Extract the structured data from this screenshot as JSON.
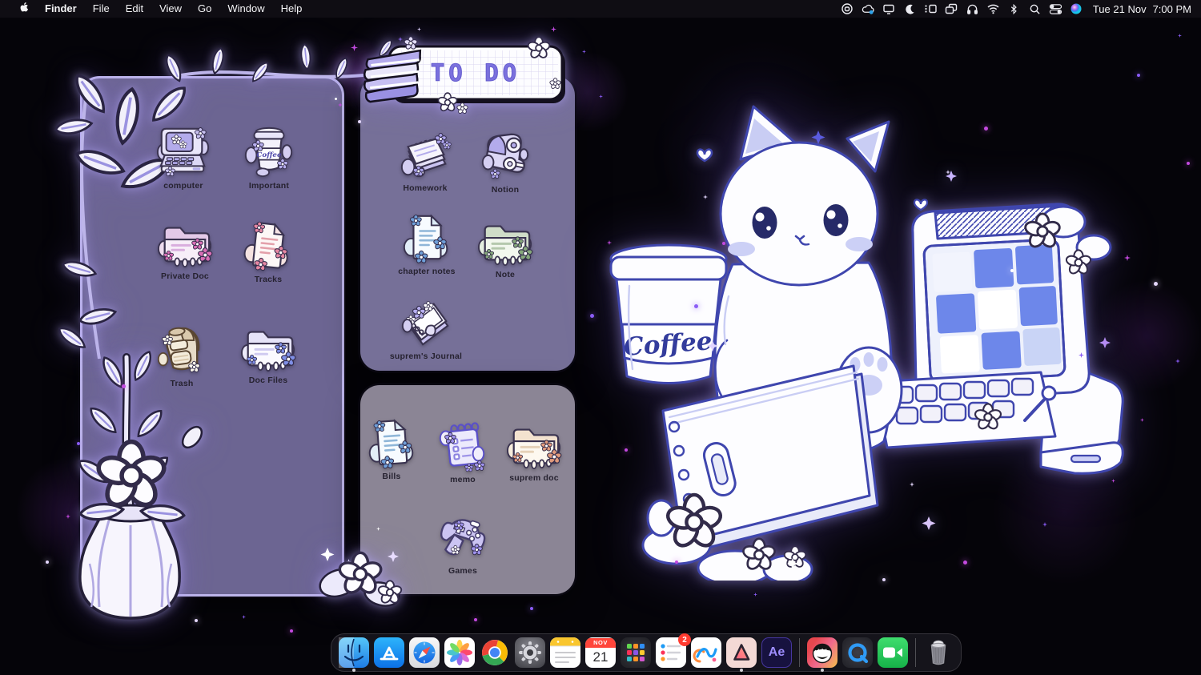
{
  "menu_bar": {
    "items": [
      "Finder",
      "File",
      "Edit",
      "View",
      "Go",
      "Window",
      "Help"
    ],
    "active_app": "Finder",
    "status_icons": [
      "record",
      "cloud-sync",
      "display",
      "focus-moon",
      "stage-manager",
      "screen-mirroring",
      "headphones",
      "wifi",
      "bluetooth",
      "spotlight",
      "control-center",
      "siri"
    ],
    "date": "Tue 21 Nov",
    "time": "7:00 PM"
  },
  "todo_banner": {
    "title": "TO DO"
  },
  "decor": {
    "cup_text": "Coffee"
  },
  "panels": {
    "left": {
      "items": [
        {
          "label": "computer",
          "icon": "retro-computer"
        },
        {
          "label": "Important",
          "icon": "coffee-cup"
        },
        {
          "label": "Private Doc",
          "icon": "pink-folder"
        },
        {
          "label": "Tracks",
          "icon": "pink-document"
        },
        {
          "label": "Trash",
          "icon": "backpack"
        },
        {
          "label": "Doc Files",
          "icon": "lavender-folder"
        }
      ]
    },
    "todo": {
      "items": [
        {
          "label": "Homework",
          "icon": "paper-stack"
        },
        {
          "label": "Notion",
          "icon": "tape-dispenser"
        },
        {
          "label": "chapter notes",
          "icon": "blue-document"
        },
        {
          "label": "Note",
          "icon": "green-folder"
        },
        {
          "label": "suprem's Journal",
          "icon": "journal"
        }
      ]
    },
    "misc": {
      "items": [
        {
          "label": "Bills",
          "icon": "blue-document"
        },
        {
          "label": "memo",
          "icon": "spiral-memo"
        },
        {
          "label": "suprem doc",
          "icon": "cream-folder"
        },
        {
          "label": "Games",
          "icon": "game-controller"
        }
      ]
    }
  },
  "dock": {
    "apps": [
      "Finder",
      "App Store",
      "Safari",
      "Photos",
      "Google Chrome",
      "System Settings",
      "Notes",
      "Calendar",
      "Launchpad",
      "Reminders",
      "Freeform",
      "Alight Motion",
      "After Effects",
      "Game",
      "QuickTime Player",
      "FaceTime"
    ],
    "calendar": {
      "month": "NOV",
      "day": "21"
    },
    "reminders_badge": "2",
    "after_effects_label": "Ae",
    "running": [
      "Finder",
      "Alight Motion",
      "Game"
    ],
    "trash": "Trash"
  },
  "colors": {
    "panel_left": "#6c6592",
    "panel_todo": "#767098",
    "panel_misc": "#8b8595",
    "accent_lavender": "#bdb5ea",
    "badge_red": "#ff3b30",
    "screen_blue": "#6d87ea"
  }
}
